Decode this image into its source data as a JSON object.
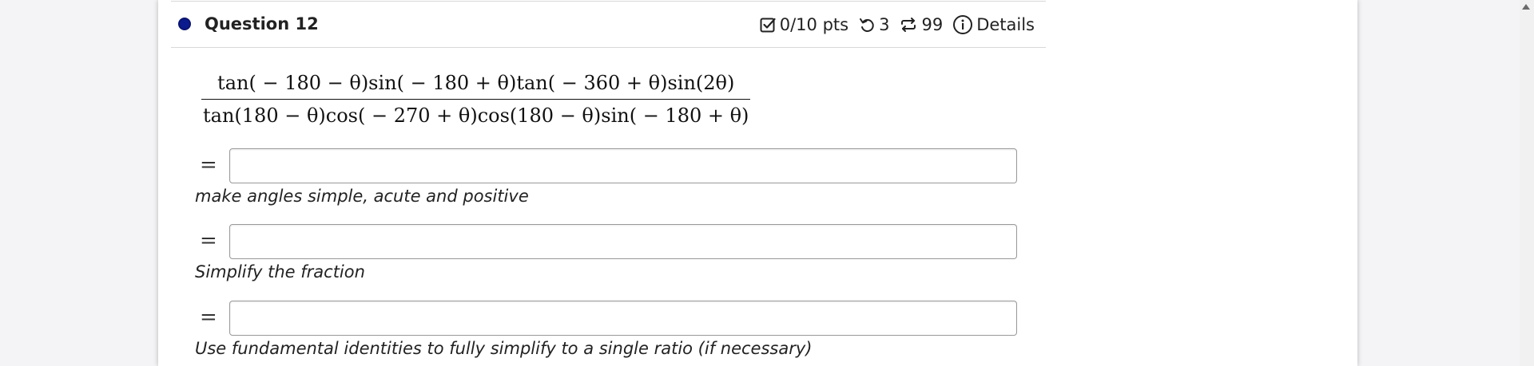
{
  "question": {
    "title": "Question 12",
    "status_color": "#0b1a8c"
  },
  "meta": {
    "score": "0/10 pts",
    "retries": "3",
    "attempts": "99",
    "details_label": "Details",
    "icons": [
      "checkbox-icon",
      "undo-icon",
      "repeat-icon",
      "info-icon"
    ]
  },
  "expression": {
    "numerator": "tan( − 180 − θ)sin( − 180 + θ)tan( − 360 + θ)sin(2θ)",
    "denominator": "tan(180 − θ)cos( − 270 + θ)cos(180 − θ)sin( − 180 + θ)"
  },
  "steps": [
    {
      "equals": "=",
      "value": "",
      "hint": "make angles simple, acute and positive"
    },
    {
      "equals": "=",
      "value": "",
      "hint": "Simplify the fraction"
    },
    {
      "equals": "=",
      "value": "",
      "hint": "Use fundamental identities to fully simplify to a single ratio (if necessary)"
    }
  ]
}
